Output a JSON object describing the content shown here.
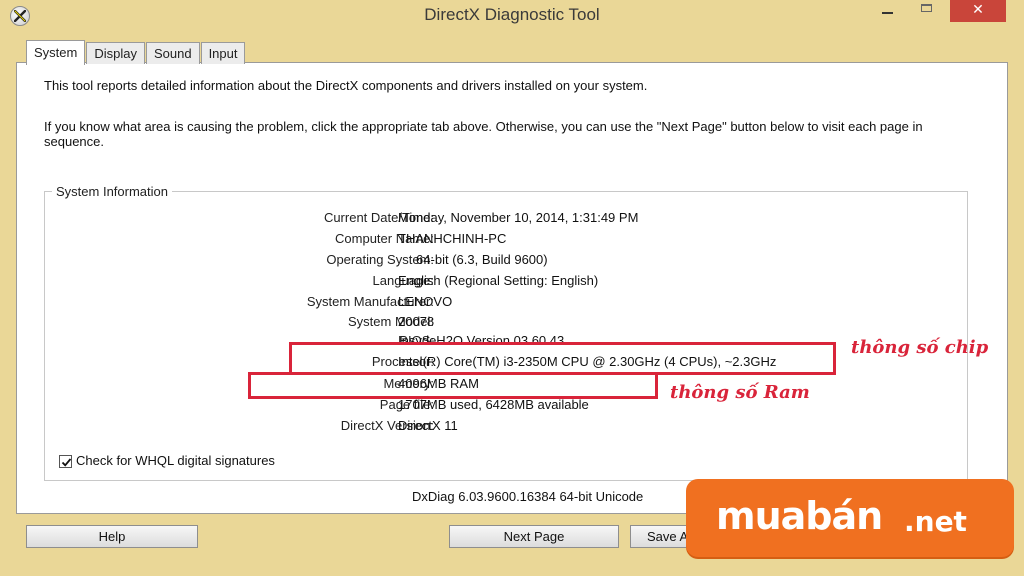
{
  "window": {
    "title": "DirectX Diagnostic Tool",
    "close_label": "✕"
  },
  "tabs": [
    {
      "label": "System",
      "active": true
    },
    {
      "label": "Display",
      "active": false
    },
    {
      "label": "Sound",
      "active": false
    },
    {
      "label": "Input",
      "active": false
    }
  ],
  "intro": {
    "line1": "This tool reports detailed information about the DirectX components and drivers installed on your system.",
    "line2": "If you know what area is causing the problem, click the appropriate tab above.  Otherwise, you can use the \"Next Page\" button below to visit each page in sequence."
  },
  "system_info": {
    "group_label": "System Information",
    "rows": [
      {
        "label": "Current Date/Time:",
        "value": "Monday, November 10, 2014, 1:31:49 PM"
      },
      {
        "label": "Computer Name:",
        "value": "THANHCHINH-PC"
      },
      {
        "label": "Operating System:",
        "value": "     64-bit (6.3, Build 9600)"
      },
      {
        "label": "Language:",
        "value": "English (Regional Setting: English)"
      },
      {
        "label": "System Manufacturer:",
        "value": "LENOVO"
      },
      {
        "label": "System Model:",
        "value": "20078"
      },
      {
        "label": "BIOS:",
        "value": "InsydeH2O Version 03.60.43"
      },
      {
        "label": "Processor:",
        "value": "Intel(R) Core(TM) i3-2350M CPU @ 2.30GHz (4 CPUs), ~2.3GHz"
      },
      {
        "label": "Memory:",
        "value": "4096MB RAM"
      },
      {
        "label": "Page file:",
        "value": "1707MB used, 6428MB available"
      },
      {
        "label": "DirectX Version:",
        "value": "DirectX 11"
      }
    ]
  },
  "annotations": {
    "chip": "thông số chip",
    "ram": "thông số Ram",
    "color": "#d9243a"
  },
  "whql": {
    "label": "Check for WHQL digital signatures",
    "checked": true
  },
  "version_text": "DxDiag 6.03.9600.16384 64-bit Unicode",
  "buttons": {
    "help": "Help",
    "next_page": "Next Page",
    "save": "Save A"
  },
  "logo": {
    "main": "muabán",
    "suffix": ".net",
    "color": "#f07020"
  },
  "icons": {
    "app": "directx-x-icon",
    "check": "checkmark-icon"
  }
}
